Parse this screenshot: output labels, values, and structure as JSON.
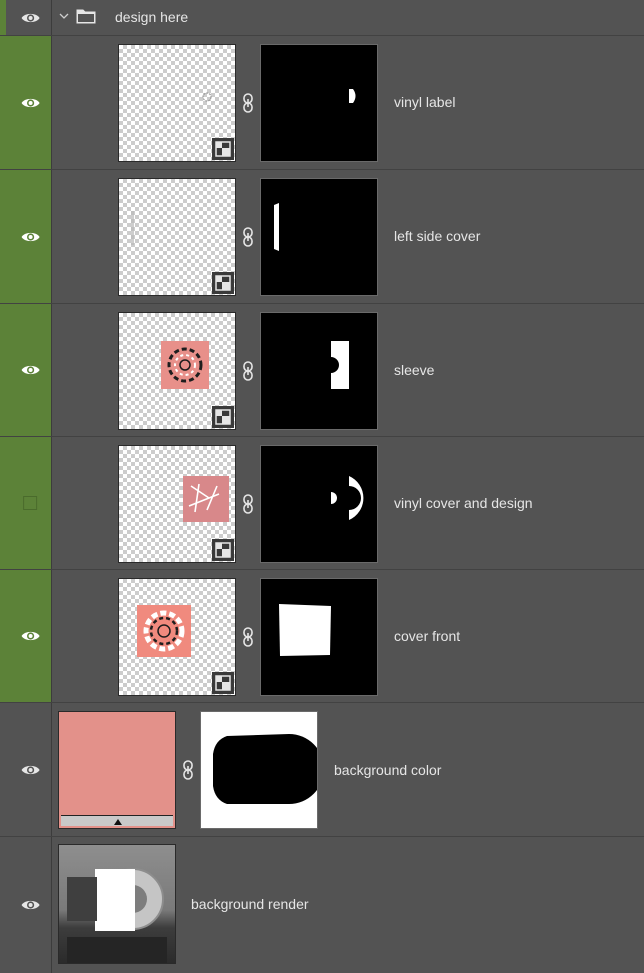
{
  "panel": {
    "group": {
      "name": "design here",
      "expanded": true,
      "visible": true
    },
    "layers": [
      {
        "name": "vinyl label",
        "visible": true,
        "kind": "smart-object-with-mask",
        "in_group": true
      },
      {
        "name": "left side cover",
        "visible": true,
        "kind": "smart-object-with-mask",
        "in_group": true
      },
      {
        "name": "sleeve",
        "visible": true,
        "kind": "smart-object-with-mask",
        "in_group": true
      },
      {
        "name": "vinyl cover and design",
        "visible": false,
        "kind": "smart-object-with-mask",
        "in_group": true
      },
      {
        "name": "cover front",
        "visible": true,
        "kind": "smart-object-with-mask",
        "in_group": true
      },
      {
        "name": "background color",
        "visible": true,
        "kind": "solid-color-fill-with-mask",
        "in_group": false
      },
      {
        "name": "background render",
        "visible": true,
        "kind": "image",
        "in_group": false
      }
    ]
  },
  "colors": {
    "group_accent": "#5c8238",
    "panel_bg": "#535353",
    "fill_swatch": "#e3918a",
    "text": "#e6e6e6"
  },
  "icons": {
    "visibility": "eye-icon",
    "hidden": "empty-visibility-box",
    "group": "folder-icon",
    "expand": "chevron-down-icon",
    "link": "chain-link-icon",
    "smart_object": "smart-object-badge-icon"
  }
}
